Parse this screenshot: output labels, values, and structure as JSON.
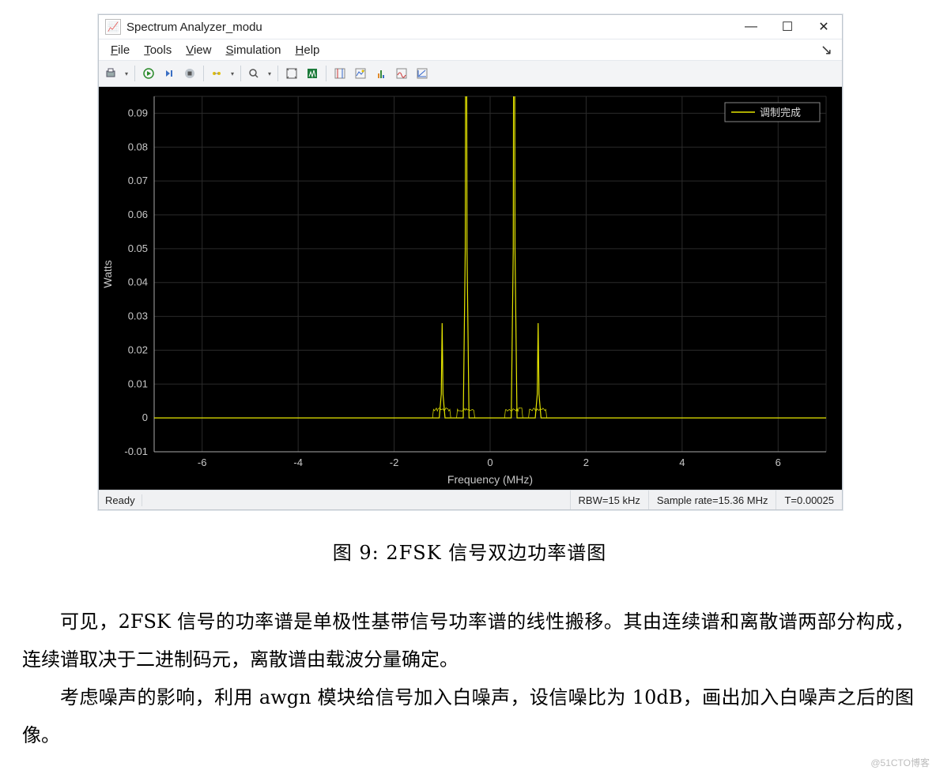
{
  "window": {
    "title": "Spectrum Analyzer_modu",
    "app_icon_text": "📈",
    "controls": {
      "minimize": "—",
      "maximize": "☐",
      "close": "✕"
    }
  },
  "menu": {
    "file": "File",
    "tools": "Tools",
    "view": "View",
    "simulation": "Simulation",
    "help": "Help"
  },
  "plot": {
    "ylabel": "Watts",
    "xlabel": "Frequency (MHz)",
    "legend": "调制完成"
  },
  "status": {
    "left": "Ready",
    "rbw": "RBW=15 kHz",
    "sample_rate": "Sample rate=15.36 MHz",
    "t": "T=0.00025"
  },
  "caption": "图 9: 2FSK 信号双边功率谱图",
  "para1": "可见，2FSK 信号的功率谱是单极性基带信号功率谱的线性搬移。其由连续谱和离散谱两部分构成，连续谱取决于二进制码元，离散谱由载波分量确定。",
  "para2": "考虑噪声的影响，利用 awgn 模块给信号加入白噪声，设信噪比为 10dB，画出加入白噪声之后的图像。",
  "watermark": "@51CTO博客",
  "chart_data": {
    "type": "line",
    "title": "",
    "xlabel": "Frequency (MHz)",
    "ylabel": "Watts",
    "xlim": [
      -7,
      7
    ],
    "ylim": [
      -0.01,
      0.095
    ],
    "xticks": [
      -6,
      -4,
      -2,
      0,
      2,
      4,
      6
    ],
    "yticks": [
      -0.01,
      0,
      0.01,
      0.02,
      0.03,
      0.04,
      0.05,
      0.06,
      0.07,
      0.08,
      0.09
    ],
    "legend": [
      "调制完成"
    ],
    "series": [
      {
        "name": "调制完成",
        "color": "#e6e600",
        "x": [
          -7,
          -1.1,
          -1.0,
          -0.9,
          -0.6,
          -0.5,
          -0.4,
          0.4,
          0.5,
          0.6,
          0.9,
          1.0,
          1.1,
          7
        ],
        "y": [
          0,
          0,
          0.028,
          0,
          0,
          0.095,
          0,
          0,
          0.095,
          0,
          0,
          0.028,
          0,
          0
        ]
      }
    ]
  }
}
